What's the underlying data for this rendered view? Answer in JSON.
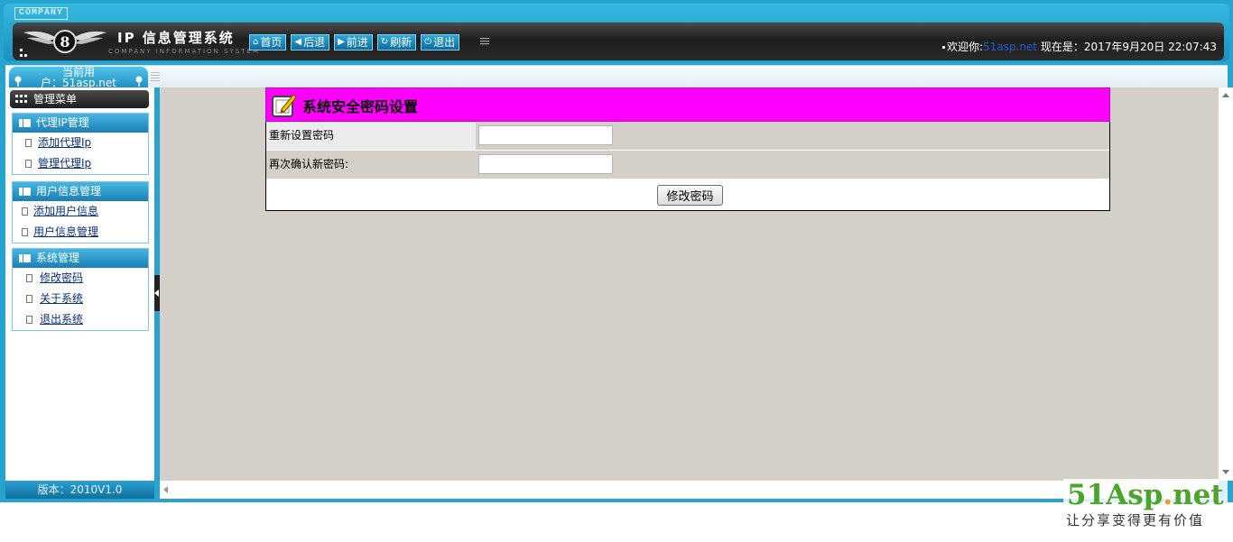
{
  "header": {
    "company_tag": "COMPANY",
    "title": "IP 信息管理系统",
    "subtitle": "COMPANY INFORMATION SYSTEM",
    "nav": [
      {
        "label": "首页",
        "icon": "home-icon"
      },
      {
        "label": "后退",
        "icon": "arrow-left-icon"
      },
      {
        "label": "前进",
        "icon": "arrow-right-icon"
      },
      {
        "label": "刷新",
        "icon": "refresh-icon"
      },
      {
        "label": "退出",
        "icon": "power-icon"
      }
    ],
    "welcome_prefix": "欢迎你:",
    "welcome_user": "51asp.net",
    "now_label": "现在是：2017年9月20日 22:07:43"
  },
  "toolbar": {
    "current_user_line1": "当前用",
    "current_user_line2": "户：51asp.net"
  },
  "sidebar": {
    "menu_title": "管理菜单",
    "groups": [
      {
        "title": "代理IP管理",
        "items": [
          "添加代理Ip",
          "管理代理Ip"
        ]
      },
      {
        "title": "用户信息管理",
        "items": [
          "添加用户信息",
          "用户信息管理"
        ]
      },
      {
        "title": "系统管理",
        "items": [
          "修改密码",
          "关于系统",
          "退出系统"
        ]
      }
    ],
    "version": "版本：2010V1.0"
  },
  "content": {
    "panel_title": "系统安全密码设置",
    "fields": [
      {
        "label": "重新设置密码",
        "value": ""
      },
      {
        "label": "再次确认新密码:",
        "value": ""
      }
    ],
    "submit_label": "修改密码"
  },
  "watermark": {
    "brand_main": "51Asp",
    "brand_dot": ".",
    "brand_tail": "net",
    "slogan": "让分享变得更有价值"
  },
  "colors": {
    "frame": "#27a3cf",
    "panel_header": "#ff00ff",
    "content_bg": "#d4d0c8"
  }
}
